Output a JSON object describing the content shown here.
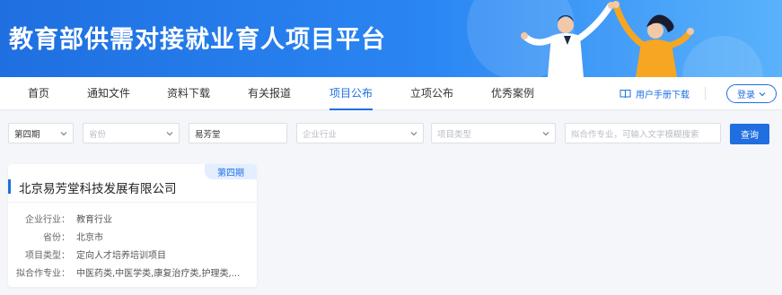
{
  "banner": {
    "title": "教育部供需对接就业育人项目平台"
  },
  "nav": {
    "items": [
      {
        "label": "首页"
      },
      {
        "label": "通知文件"
      },
      {
        "label": "资料下载"
      },
      {
        "label": "有关报道"
      },
      {
        "label": "项目公布",
        "active": true
      },
      {
        "label": "立项公布"
      },
      {
        "label": "优秀案例"
      }
    ],
    "manual_label": "用户手册下载",
    "login_label": "登录"
  },
  "filters": {
    "phase": "第四期",
    "province_placeholder": "省份",
    "keyword": "易芳堂",
    "industry_placeholder": "企业行业",
    "type_placeholder": "项目类型",
    "major_placeholder": "拟合作专业，可输入文字模糊搜索",
    "query_label": "查询"
  },
  "card": {
    "phase_badge": "第四期",
    "company": "北京易芳堂科技发展有限公司",
    "fields": [
      {
        "key": "企业行业：",
        "value": "教育行业"
      },
      {
        "key": "省份：",
        "value": "北京市"
      },
      {
        "key": "项目类型：",
        "value": "定向人才培养培训项目"
      },
      {
        "key": "拟合作专业：",
        "value": "中医药类,中医学类,康复治疗类,护理类,..."
      }
    ]
  },
  "colors": {
    "primary": "#1f6fe0",
    "badge_bg": "#e3efff"
  }
}
